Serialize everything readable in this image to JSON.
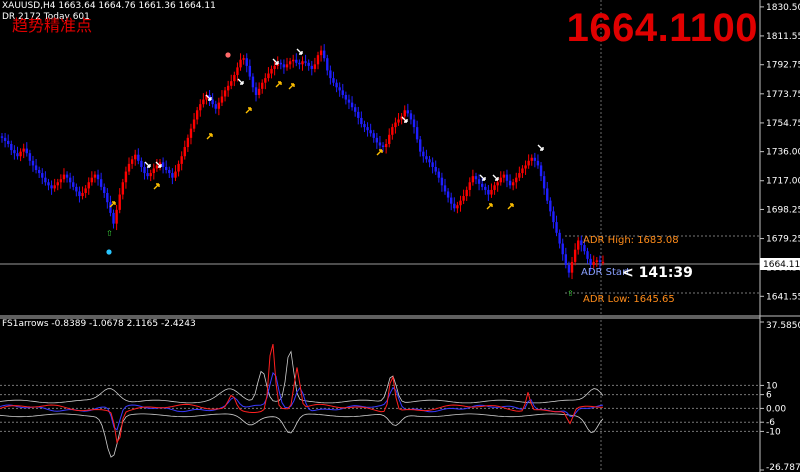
{
  "header": {
    "line1": "XAUUSD,H4  1663.64 1664.76 1661.36 1664.11",
    "line2": "DR 2172  Today 601",
    "chinese_title": "趋势精准点",
    "big_price": "1664.1100"
  },
  "price_panel": {
    "y_axis_ticks": [
      "1830.50",
      "1811.55",
      "1792.75",
      "1773.75",
      "1754.75",
      "1736.00",
      "1717.00",
      "1698.25",
      "1679.25",
      "1660.30",
      "1641.55"
    ],
    "current_price_tag": "1664.11",
    "adr_high_label": "ADR High: 1683.08",
    "adr_start_label": "ADR Start",
    "adr_low_label": "ADR Low: 1645.65",
    "countdown": "< 141:39",
    "colors": {
      "up": "#ff0000",
      "down": "#1f1fff",
      "arrow_sell": "#ffffff",
      "arrow_buy": "#ffc000",
      "adr": "#ff8c1a",
      "adr_start": "#8aa0ff"
    }
  },
  "indicator_panel": {
    "label": "FS1arrows -0.8389 -1.0678 2.1165 -2.4243",
    "y_axis_ticks": [
      "37.5850",
      "10",
      "6",
      "0.00",
      "-6",
      "-10",
      "-26.7877"
    ]
  },
  "chart_data": {
    "type": "line",
    "title": "XAUUSD,H4",
    "y_range": [
      1630,
      1835
    ],
    "closes": [
      1745,
      1743,
      1741,
      1737,
      1735,
      1733,
      1736,
      1738,
      1735,
      1730,
      1727,
      1724,
      1722,
      1719,
      1716,
      1714,
      1712,
      1714,
      1716,
      1718,
      1721,
      1719,
      1716,
      1713,
      1710,
      1707,
      1709,
      1712,
      1716,
      1719,
      1721,
      1718,
      1713,
      1709,
      1703,
      1696,
      1689,
      1698,
      1708,
      1716,
      1723,
      1728,
      1731,
      1734,
      1730,
      1726,
      1722,
      1720,
      1722,
      1725,
      1727,
      1729,
      1726,
      1724,
      1722,
      1719,
      1723,
      1728,
      1733,
      1739,
      1745,
      1751,
      1757,
      1763,
      1767,
      1770,
      1773,
      1770,
      1767,
      1764,
      1768,
      1772,
      1776,
      1779,
      1782,
      1786,
      1791,
      1796,
      1797,
      1792,
      1785,
      1778,
      1773,
      1777,
      1781,
      1784,
      1787,
      1790,
      1792,
      1794,
      1793,
      1791,
      1793,
      1795,
      1796,
      1794,
      1793,
      1795,
      1794,
      1792,
      1790,
      1793,
      1799,
      1802,
      1797,
      1789,
      1784,
      1781,
      1778,
      1776,
      1773,
      1770,
      1768,
      1765,
      1762,
      1758,
      1754,
      1752,
      1750,
      1748,
      1745,
      1742,
      1740,
      1739,
      1741,
      1747,
      1752,
      1755,
      1757,
      1759,
      1763,
      1761,
      1757,
      1752,
      1744,
      1736,
      1733,
      1731,
      1729,
      1726,
      1723,
      1719,
      1714,
      1710,
      1706,
      1702,
      1699,
      1701,
      1704,
      1707,
      1711,
      1716,
      1720,
      1718,
      1715,
      1713,
      1711,
      1708,
      1711,
      1714,
      1716,
      1719,
      1721,
      1717,
      1714,
      1716,
      1719,
      1722,
      1725,
      1727,
      1730,
      1732,
      1730,
      1727,
      1720,
      1712,
      1704,
      1697,
      1690,
      1683,
      1676,
      1669,
      1662,
      1657,
      1664,
      1672,
      1678,
      1675,
      1671,
      1666,
      1662,
      1664,
      1665,
      1664,
      1664
    ]
  }
}
